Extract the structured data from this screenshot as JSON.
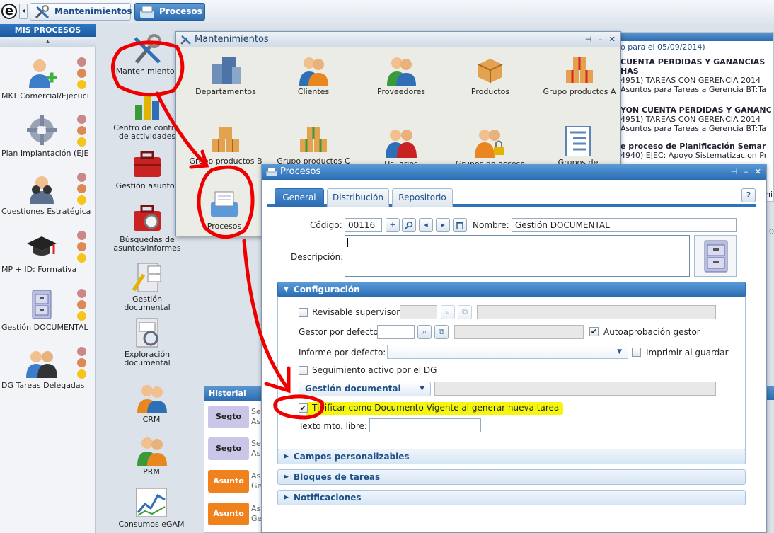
{
  "taskbar": {
    "logo": "e",
    "back_arrow": "◂",
    "tab1_label": "Mantenimientos",
    "tab2_label": "Procesos"
  },
  "sidebar": {
    "title": "MIS PROCESOS",
    "scroll_up": "▴",
    "items": [
      {
        "label": "MKT Comercial/Ejecuci",
        "icon": "user-add-icon"
      },
      {
        "label": "Plan Implantación (EJE",
        "icon": "gear-icon"
      },
      {
        "label": "Cuestiones Estratégica",
        "icon": "binoculars-icon"
      },
      {
        "label": "MP + ID: Formativa",
        "icon": "graduation-cap-icon"
      },
      {
        "label": "Gestión DOCUMENTAL",
        "icon": "filing-cabinet-icon"
      },
      {
        "label": "DG Tareas Delegadas",
        "icon": "users-icon"
      }
    ]
  },
  "desktop": {
    "icons": [
      {
        "label": "Mantenimientos",
        "icon": "tools-icon"
      },
      {
        "label": "Centro de control de actividades",
        "icon": "chart-icon"
      },
      {
        "label": "Gestión asuntos",
        "icon": "briefcase-icon"
      },
      {
        "label": "Búsquedas de asuntos/Informes",
        "icon": "briefcase-search-icon"
      },
      {
        "label": "Gestión documental",
        "icon": "document-cabinet-icon"
      },
      {
        "label": "Exploración documental",
        "icon": "document-search-icon"
      },
      {
        "label": "CRM",
        "icon": "crm-icon"
      },
      {
        "label": "PRM",
        "icon": "prm-icon"
      },
      {
        "label": "Consumos eGAM",
        "icon": "line-chart-icon"
      }
    ]
  },
  "right_panel": {
    "lines": [
      "o para el 05/09/2014)",
      "CUENTA PERDIDAS Y GANANCIAS HAS",
      "4951) TAREAS CON GERENCIA 2014",
      "Asuntos para Tareas a Gerencia BT:Ta",
      "YON CUENTA PERDIDAS Y GANANC",
      "4951) TAREAS CON GERENCIA 2014",
      "Asuntos para Tareas a Gerencia BT:Ta",
      "e proceso de Planificación Semar",
      "4940) EJEC: Apoyo Sistematizacion Pr"
    ],
    "side_letters": [
      "ni",
      "0"
    ]
  },
  "historial": {
    "title": "Historial",
    "rows": [
      {
        "tag": "Segto",
        "text1": "Se",
        "text2": "As"
      },
      {
        "tag": "Segto",
        "text1": "Se",
        "text2": "As"
      },
      {
        "tag": "Asunto",
        "text1": "As",
        "text2": "Ge"
      },
      {
        "tag": "Asunto",
        "text1": "As",
        "text2": "Ge"
      }
    ]
  },
  "mant_window": {
    "title": "Mantenimientos",
    "controls": "⊣ – ✕",
    "items": [
      {
        "label": "Departamentos",
        "icon": "buildings-icon"
      },
      {
        "label": "Clientes",
        "icon": "clients-icon"
      },
      {
        "label": "Proveedores",
        "icon": "suppliers-icon"
      },
      {
        "label": "Productos",
        "icon": "box-icon"
      },
      {
        "label": "Grupo productos A",
        "icon": "boxes-red-icon"
      },
      {
        "label": "Grupo productos B",
        "icon": "boxes-brown-icon"
      },
      {
        "label": "Grupo productos C",
        "icon": "boxes-green-icon"
      },
      {
        "label": "Usuarios",
        "icon": "users-icon"
      },
      {
        "label": "Grupos de acceso",
        "icon": "users-lock-icon"
      },
      {
        "label": "Grupos de distribución",
        "icon": "distribution-list-icon"
      },
      {
        "label": "Procesos",
        "icon": "process-icon"
      }
    ]
  },
  "proc_window": {
    "title": "Procesos",
    "controls": "⊣ – ✕",
    "tabs": [
      "General",
      "Distribución",
      "Repositorio"
    ],
    "help": "?",
    "codigo_label": "Código:",
    "codigo_value": "00116",
    "nombre_label": "Nombre:",
    "nombre_value": "Gestión DOCUMENTAL",
    "descripcion_label": "Descripción:",
    "descripcion_value": "",
    "config_title": "Configuración",
    "revisable_label": "Revisable supervisor",
    "gestor_label": "Gestor por defecto",
    "autoaprobacion_label": "Autoaprobación gestor",
    "informe_label": "Informe por defecto:",
    "imprimir_label": "Imprimir al guardar",
    "seguimiento_label": "Seguimiento activo por el DG",
    "gestion_doc_label": "Gestión documental",
    "tipificar_label": "Tipificar como Documento Vigente al generar nueva tarea",
    "texto_mto_label": "Texto mto. libre:",
    "texto_mto_value": "",
    "sections": [
      "Campos personalizables",
      "Bloques de tareas",
      "Notificaciones"
    ],
    "checks": {
      "revisable": false,
      "autoaprobacion": true,
      "imprimir": false,
      "seguimiento": false,
      "tipificar": true
    }
  },
  "colors": {
    "accent": "#2b6db3",
    "annotation_red": "#ee0000",
    "highlight_yellow": "#f3f700",
    "tag_segto": "#c9c6e8",
    "tag_asunto": "#f0821e"
  }
}
